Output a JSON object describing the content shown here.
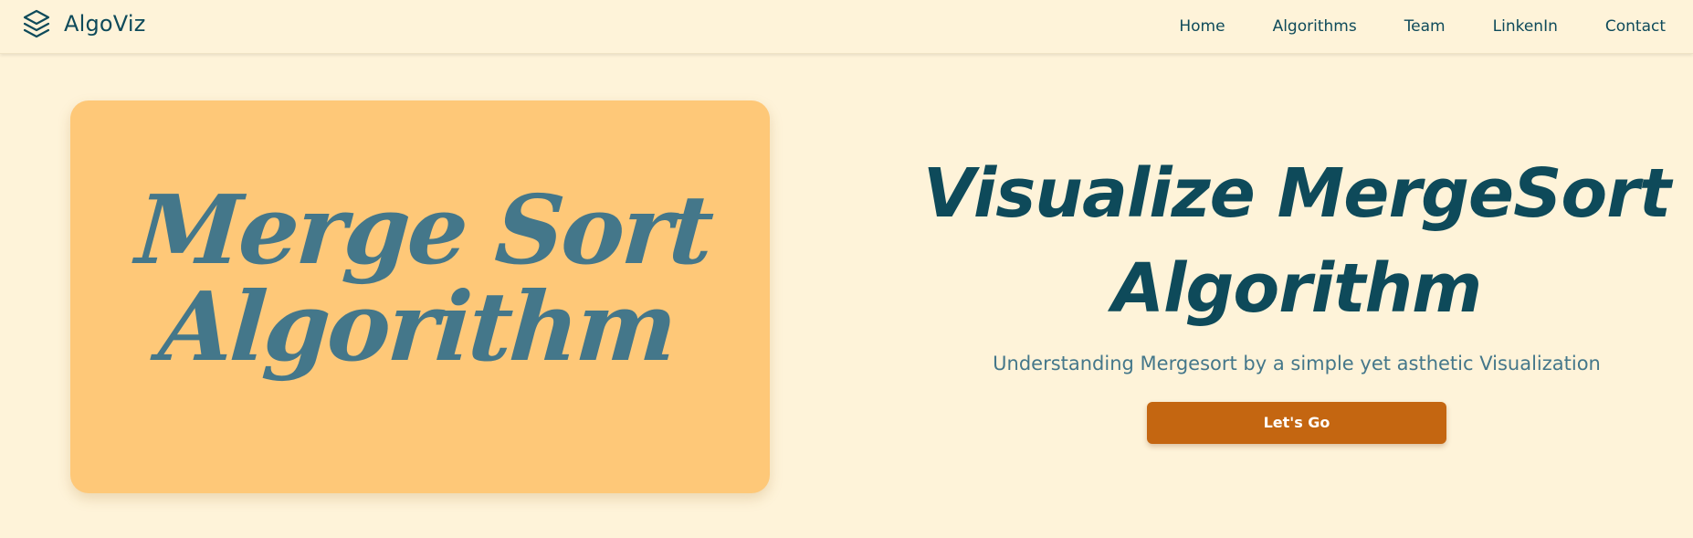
{
  "nav": {
    "brand": "AlgoViz",
    "brand_icon": "layers-icon",
    "links": [
      "Home",
      "Algorithms",
      "Team",
      "LinkenIn",
      "Contact"
    ]
  },
  "card": {
    "title_line1": "Merge Sort",
    "title_line2": "Algorithm"
  },
  "hero": {
    "title_line1": "Visualize MergeSort",
    "title_line2": "Algorithm",
    "subtitle": "Understanding Mergesort by a simple yet asthetic Visualization",
    "cta_label": "Let's Go"
  },
  "colors": {
    "background": "#fef3d9",
    "card": "#fec878",
    "primary_text": "#0e4a5a",
    "muted_text": "#44778a",
    "cta": "#c46611"
  }
}
